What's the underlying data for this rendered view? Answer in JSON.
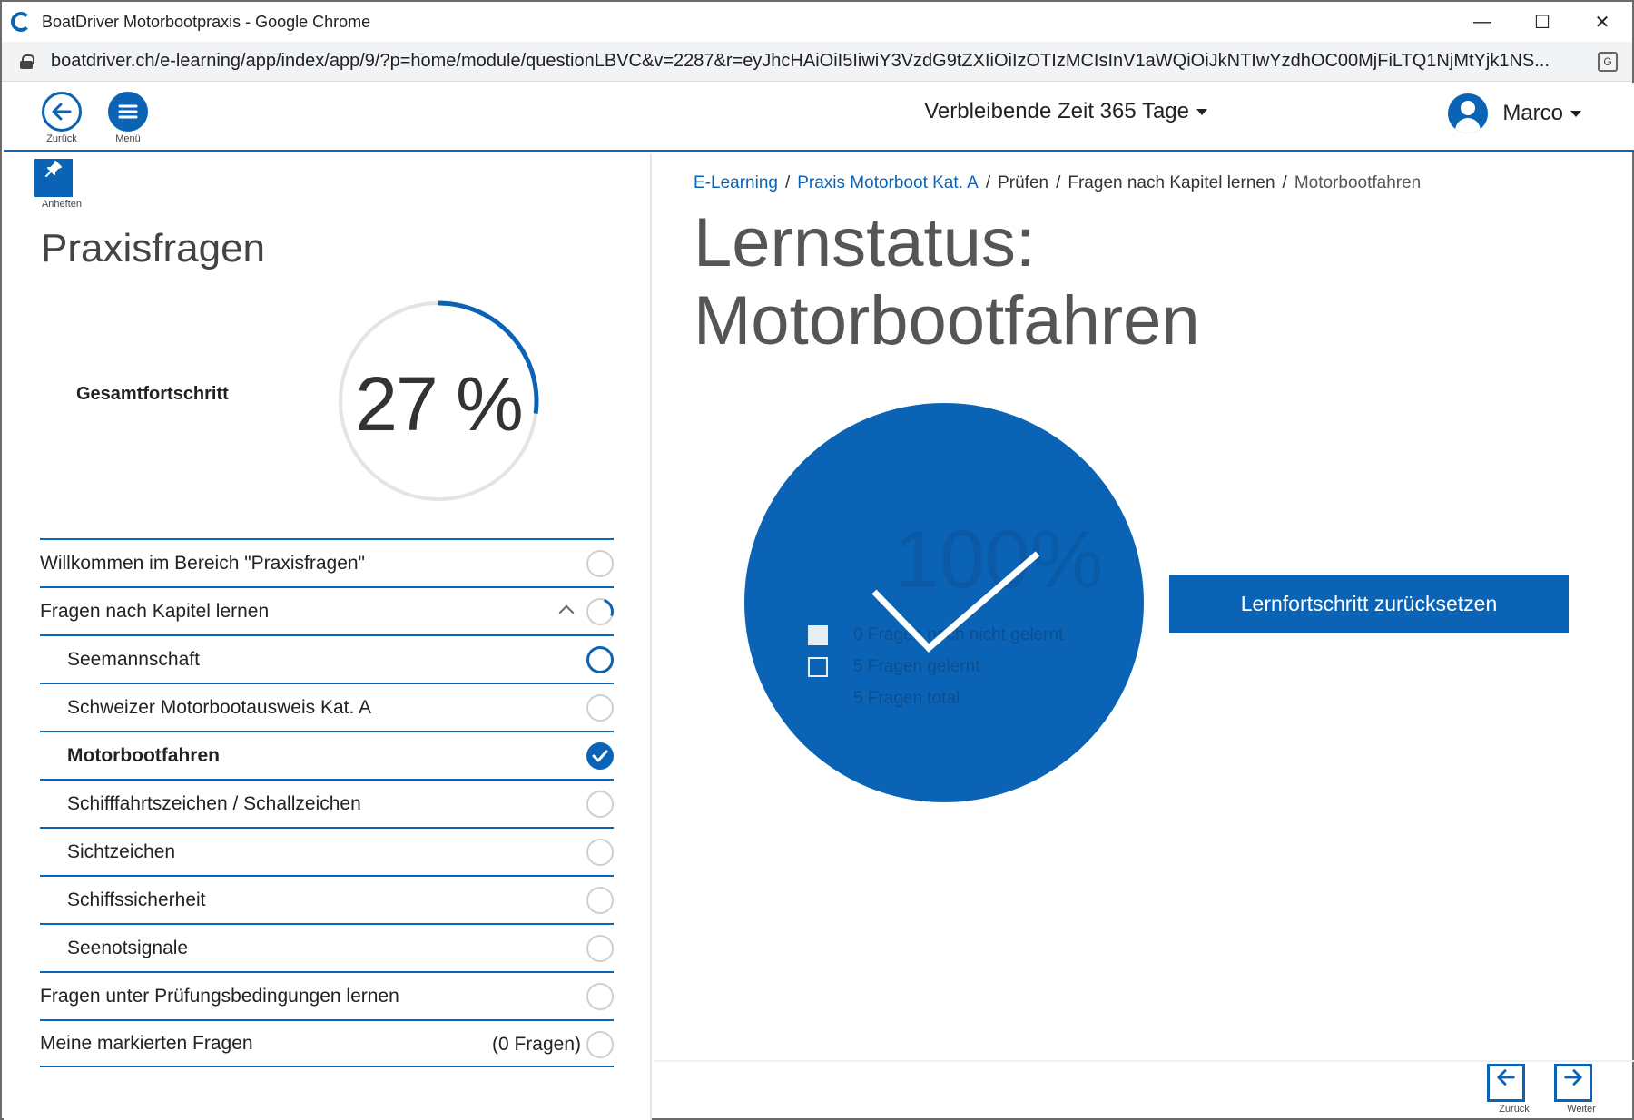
{
  "window": {
    "title": "BoatDriver Motorbootpraxis - Google Chrome",
    "url": "boatdriver.ch/e-learning/app/index/app/9/?p=home/module/questionLBVC&v=2287&r=eyJhcHAiOiI5IiwiY3VzdG9tZXIiOiIzOTIzMCIsInV1aWQiOiJkNTIwYzdhOC00MjFiLTQ1NjMtYjk1NS..."
  },
  "header": {
    "back_caption": "Zurück",
    "menu_caption": "Menü",
    "time_remaining": "Verbleibende Zeit 365 Tage",
    "user_name": "Marco"
  },
  "sidebar": {
    "pin_caption": "Anheften",
    "title": "Praxisfragen",
    "progress_label": "Gesamtfortschritt",
    "progress_text": "27 %",
    "progress_fraction": 0.27,
    "items": [
      {
        "label": "Willkommen im Bereich \"Praxisfragen\"",
        "status": "empty",
        "sub": false
      },
      {
        "label": "Fragen nach Kapitel lernen",
        "status": "partial",
        "sub": false,
        "expanded": true
      },
      {
        "label": "Seemannschaft",
        "status": "open",
        "sub": true
      },
      {
        "label": "Schweizer Motorbootausweis Kat. A",
        "status": "empty",
        "sub": true
      },
      {
        "label": "Motorbootfahren",
        "status": "done",
        "sub": true,
        "active": true
      },
      {
        "label": "Schifffahrtszeichen / Schallzeichen",
        "status": "empty",
        "sub": true
      },
      {
        "label": "Sichtzeichen",
        "status": "empty",
        "sub": true
      },
      {
        "label": "Schiffssicherheit",
        "status": "empty",
        "sub": true
      },
      {
        "label": "Seenotsignale",
        "status": "empty",
        "sub": true
      },
      {
        "label": "Fragen unter Prüfungsbedingungen lernen",
        "status": "empty",
        "sub": false
      },
      {
        "label": "Meine markierten Fragen",
        "status": "empty",
        "sub": false,
        "note": "(0 Fragen)"
      }
    ]
  },
  "main": {
    "breadcrumb": {
      "item1": "E-Learning",
      "item2": "Praxis Motorboot Kat. A",
      "item3": "Prüfen",
      "item4": "Fragen nach Kapitel lernen",
      "item5": "Motorbootfahren",
      "sep": "/"
    },
    "title_line1": "Lernstatus:",
    "title_line2": "Motorbootfahren",
    "status": {
      "percent_text": "100%",
      "legend_not_learned": "0  Fragen noch nicht gelernt",
      "legend_learned": "5  Fragen gelernt",
      "legend_total": "5  Fragen total"
    },
    "reset_button": "Lernfortschritt zurücksetzen",
    "footer": {
      "back_caption": "Zurück",
      "next_caption": "Weiter"
    }
  },
  "colors": {
    "accent": "#0b63b5"
  }
}
